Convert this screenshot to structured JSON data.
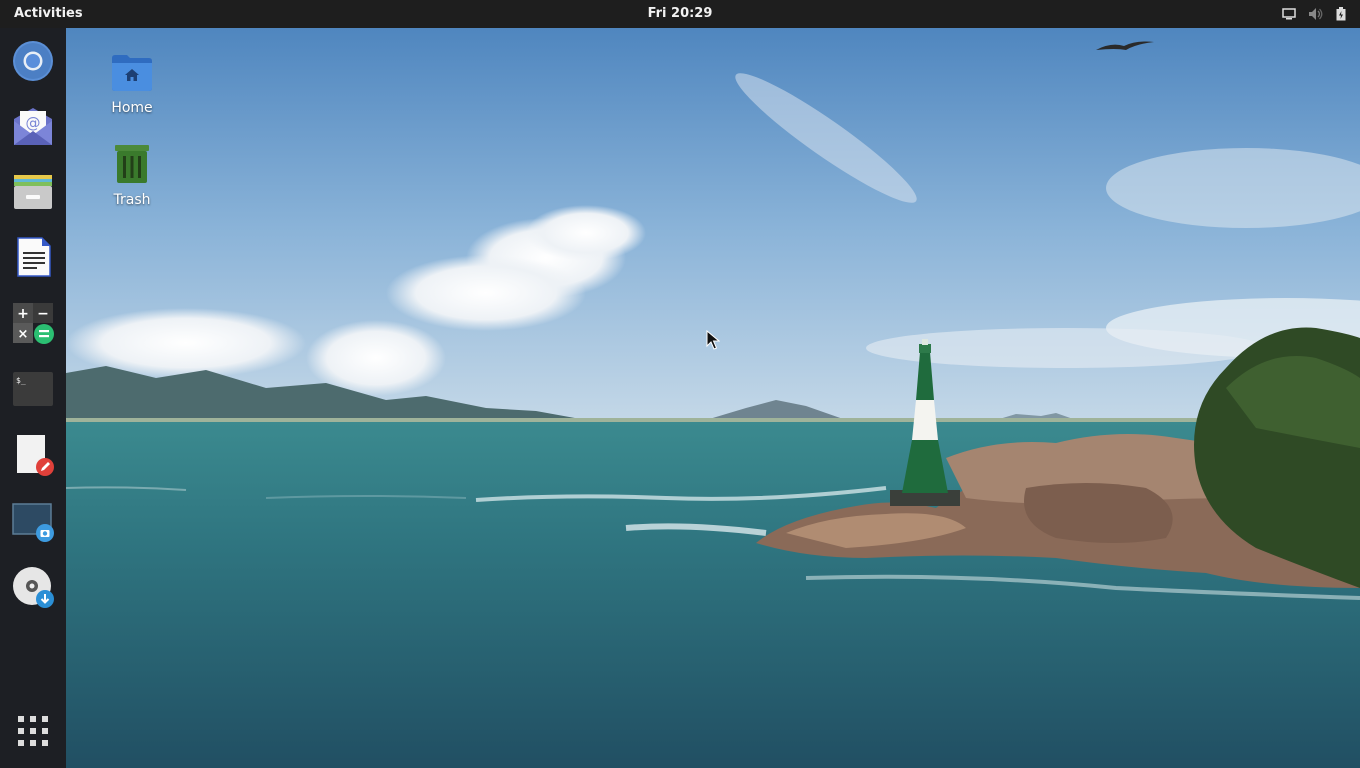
{
  "topbar": {
    "activities_label": "Activities",
    "clock": "Fri 20:29",
    "tray_icons": [
      "screen-icon",
      "volume-muted-icon",
      "battery-icon"
    ]
  },
  "dock": {
    "items": [
      {
        "name": "chromium-browser",
        "icon": "browser-icon"
      },
      {
        "name": "mail-client",
        "icon": "mail-icon"
      },
      {
        "name": "archive-manager",
        "icon": "archive-icon"
      },
      {
        "name": "document-writer",
        "icon": "document-icon"
      },
      {
        "name": "calculator",
        "icon": "calculator-icon"
      },
      {
        "name": "terminal",
        "icon": "terminal-icon"
      },
      {
        "name": "text-editor",
        "icon": "text-editor-icon"
      },
      {
        "name": "screenshot",
        "icon": "screenshot-icon"
      },
      {
        "name": "disc-burner",
        "icon": "disc-icon"
      }
    ],
    "app_grid_icon": "app-grid-icon"
  },
  "desktop": {
    "icons": [
      {
        "label": "Home",
        "icon": "home-folder-icon"
      },
      {
        "label": "Trash",
        "icon": "trash-icon"
      }
    ]
  },
  "colors": {
    "topbar_bg": "#1e1e1e",
    "dock_bg": "#1d1f24",
    "sky": "#6f9fc9",
    "sea": "#2f6e78",
    "lighthouse_green": "#1f6b3d"
  }
}
